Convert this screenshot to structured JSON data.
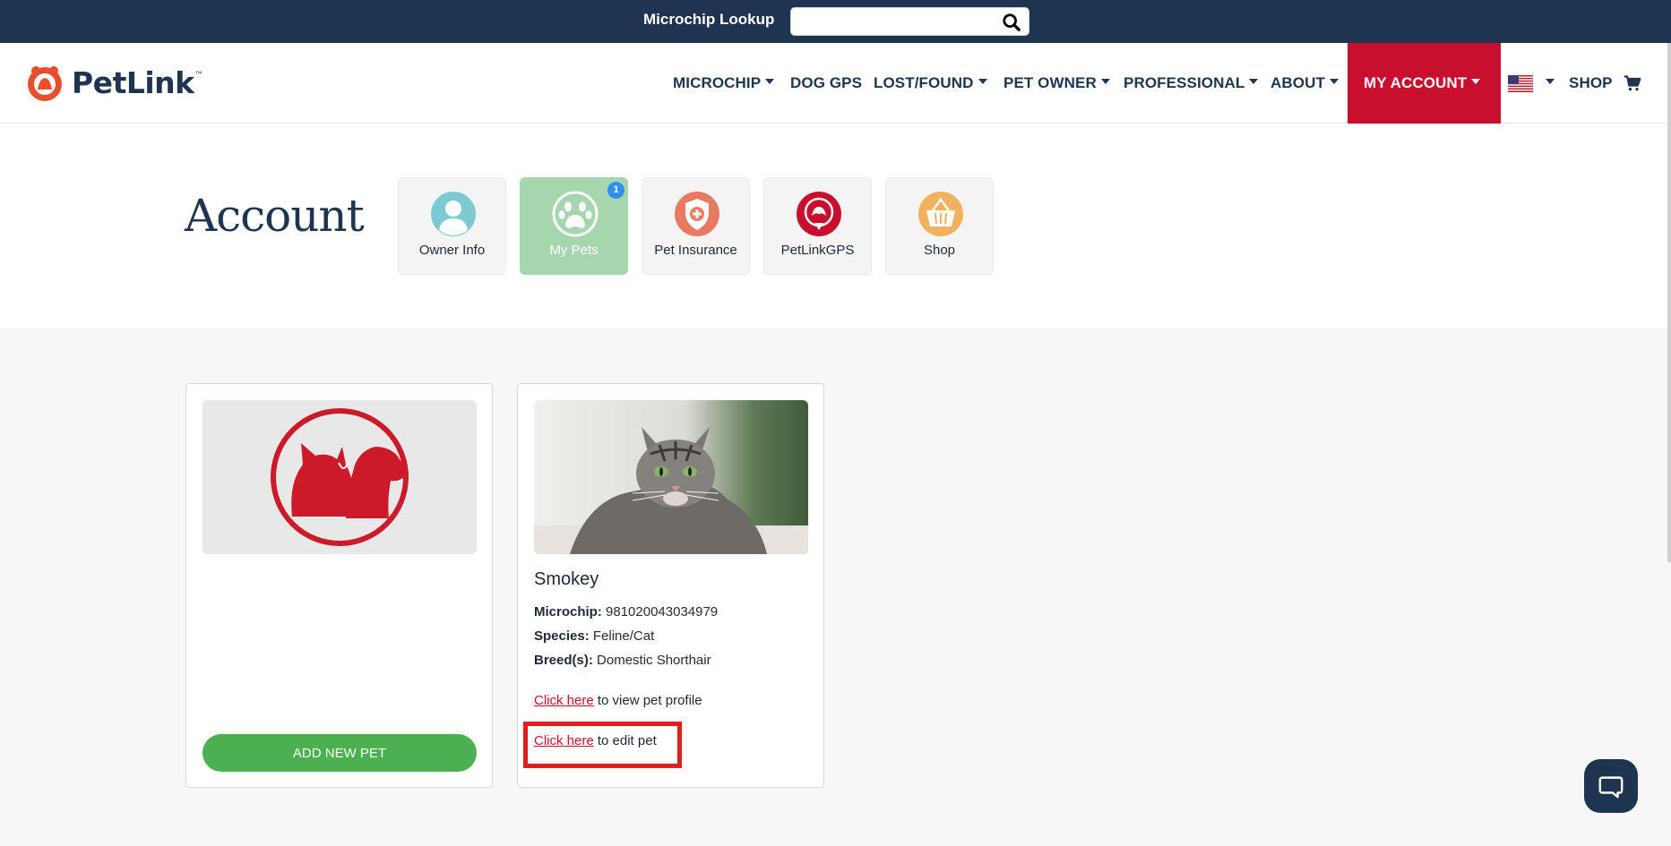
{
  "topbar": {
    "lookup_label": "Microchip Lookup",
    "lookup_value": "",
    "lookup_placeholder": ""
  },
  "brand": {
    "name": "PetLink",
    "tm": "™",
    "accent": "#c8102e",
    "navy": "#1f3450"
  },
  "nav": {
    "items": [
      {
        "label": "MICROCHIP",
        "dropdown": true
      },
      {
        "label": "DOG GPS",
        "dropdown": false
      },
      {
        "label": "LOST/FOUND",
        "dropdown": true
      },
      {
        "label": "PET OWNER",
        "dropdown": true
      },
      {
        "label": "PROFESSIONAL",
        "dropdown": true
      },
      {
        "label": "ABOUT",
        "dropdown": true
      },
      {
        "label": "MY ACCOUNT",
        "dropdown": true,
        "active": true
      }
    ],
    "language_icon": "us-flag-icon",
    "shop_label": "SHOP",
    "cart_icon": "cart-icon"
  },
  "account": {
    "title": "Account",
    "tiles": [
      {
        "label": "Owner Info",
        "icon": "person-icon"
      },
      {
        "label": "My Pets",
        "icon": "paw-icon",
        "active": true,
        "badge": "1"
      },
      {
        "label": "Pet Insurance",
        "icon": "shield-cross-icon"
      },
      {
        "label": "PetLinkGPS",
        "icon": "gps-pin-icon"
      },
      {
        "label": "Shop",
        "icon": "basket-icon"
      }
    ]
  },
  "cards": {
    "add_card": {
      "button_label": "ADD NEW PET",
      "button_color": "#4caf50"
    },
    "pet": {
      "name": "Smokey",
      "microchip_label": "Microchip:",
      "microchip": "981020043034979",
      "species_label": "Species:",
      "species": "Feline/Cat",
      "breed_label": "Breed(s):",
      "breed": "Domestic Shorthair",
      "view_link": "Click here",
      "view_text": " to view pet profile",
      "edit_link": "Click here",
      "edit_text": " to edit pet"
    }
  },
  "chat": {
    "icon": "chat-bubble-icon"
  }
}
